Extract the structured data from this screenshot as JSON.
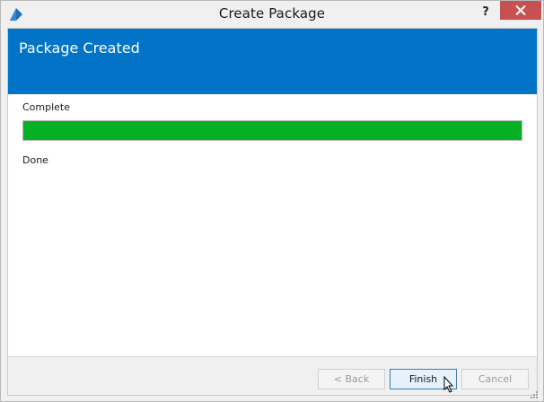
{
  "window": {
    "title": "Create Package",
    "help_glyph": "?",
    "app_icon": "app-logo-icon",
    "close_icon": "close-icon"
  },
  "header": {
    "title": "Package Created",
    "background_color": "#0174c7"
  },
  "progress": {
    "status_label": "Complete",
    "percent": 100,
    "fill_color": "#06b025",
    "detail_label": "Done"
  },
  "buttons": {
    "back_label": "< Back",
    "finish_label": "Finish",
    "cancel_label": "Cancel"
  }
}
